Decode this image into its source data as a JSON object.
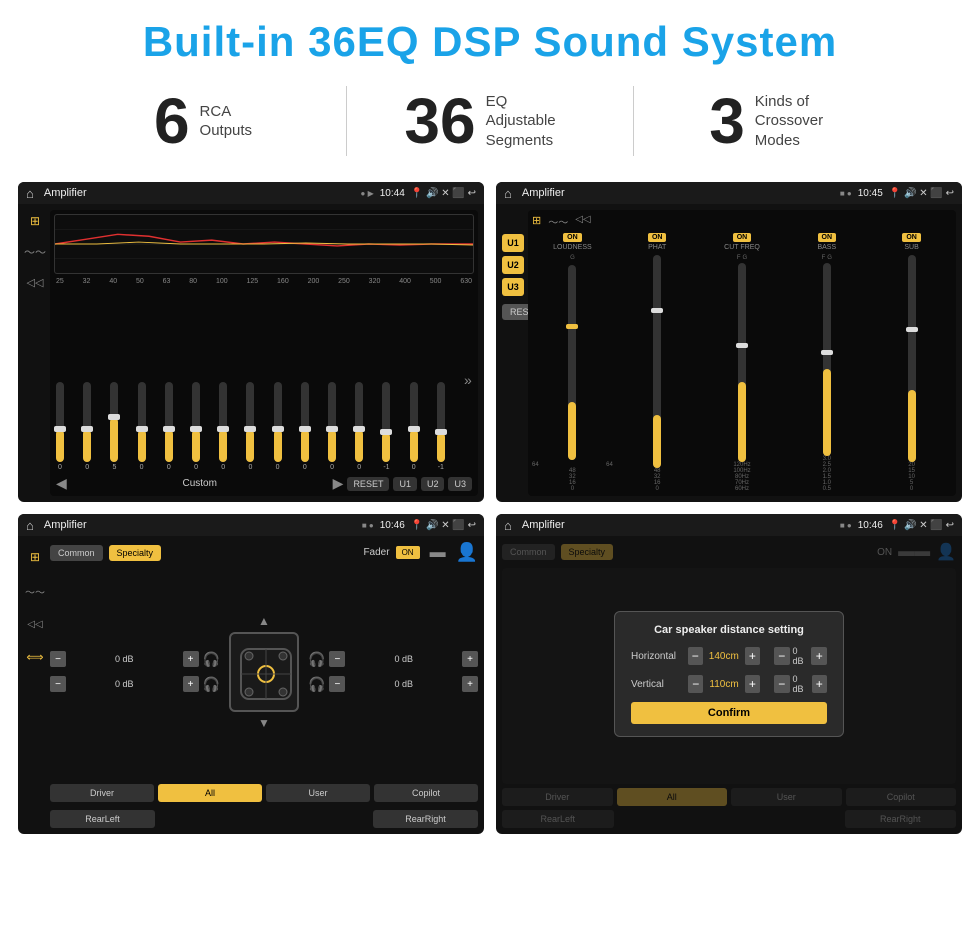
{
  "header": {
    "title": "Built-in 36EQ DSP Sound System"
  },
  "stats": [
    {
      "number": "6",
      "label": "RCA\nOutputs"
    },
    {
      "number": "36",
      "label": "EQ Adjustable\nSegments"
    },
    {
      "number": "3",
      "label": "Kinds of\nCrossover Modes"
    }
  ],
  "screens": {
    "eq": {
      "title": "Amplifier",
      "time": "10:44",
      "preset": "Custom",
      "freqs": [
        "25",
        "32",
        "40",
        "50",
        "63",
        "80",
        "100",
        "125",
        "160",
        "200",
        "250",
        "320",
        "400",
        "500",
        "630"
      ],
      "values": [
        "0",
        "0",
        "5",
        "0",
        "0",
        "0",
        "0",
        "0",
        "0",
        "0",
        "0",
        "0",
        "-1",
        "0",
        "-1"
      ],
      "buttons": [
        "RESET",
        "U1",
        "U2",
        "U3"
      ]
    },
    "amplifier": {
      "title": "Amplifier",
      "time": "10:45",
      "units": [
        "U1",
        "U2",
        "U3"
      ],
      "controls": [
        {
          "label": "LOUDNESS",
          "on": true
        },
        {
          "label": "PHAT",
          "on": true
        },
        {
          "label": "CUT FREQ",
          "on": true
        },
        {
          "label": "BASS",
          "on": true
        },
        {
          "label": "SUB",
          "on": true
        }
      ],
      "reset": "RESET"
    },
    "fader": {
      "title": "Amplifier",
      "time": "10:46",
      "tabs": [
        "Common",
        "Specialty"
      ],
      "faderLabel": "Fader",
      "faderOn": "ON",
      "channels": [
        {
          "label": "0 dB",
          "side": "left"
        },
        {
          "label": "0 dB",
          "side": "left"
        },
        {
          "label": "0 dB",
          "side": "right"
        },
        {
          "label": "0 dB",
          "side": "right"
        }
      ],
      "buttons": [
        "Driver",
        "RearLeft",
        "All",
        "User",
        "Copilot",
        "RearRight"
      ]
    },
    "distance": {
      "title": "Amplifier",
      "time": "10:46",
      "dialog": {
        "title": "Car speaker distance setting",
        "horizontal": {
          "label": "Horizontal",
          "value": "140cm"
        },
        "vertical": {
          "label": "Vertical",
          "value": "110cm"
        },
        "confirm": "Confirm"
      },
      "tabs": [
        "Common",
        "Specialty"
      ],
      "buttons": [
        "Driver",
        "RearLeft",
        "All",
        "User",
        "Copilot",
        "RearRight"
      ]
    }
  },
  "colors": {
    "accent": "#f0c040",
    "bg_dark": "#111111",
    "bg_screen": "#0a0a0a",
    "text_light": "#eeeeee",
    "text_gray": "#888888",
    "brand_blue": "#1aa3e8"
  }
}
